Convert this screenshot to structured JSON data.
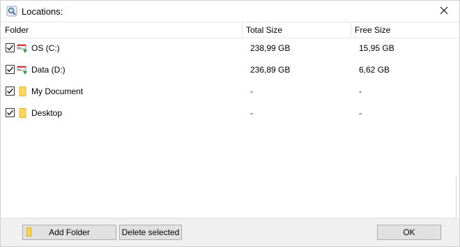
{
  "window": {
    "title": "Locations:",
    "title_icon": "magnifier-icon",
    "close_icon": "close-icon"
  },
  "table": {
    "columns": [
      "Folder",
      "Total Size",
      "Free Size"
    ],
    "rows": [
      {
        "checked": true,
        "icon": "drive-icon",
        "name": "OS (C:)",
        "total": "238,99 GB",
        "free": "15,95 GB"
      },
      {
        "checked": true,
        "icon": "drive-icon",
        "name": "Data (D:)",
        "total": "236,89 GB",
        "free": "6,62 GB"
      },
      {
        "checked": true,
        "icon": "folder-icon",
        "name": "My Document",
        "total": "-",
        "free": "-"
      },
      {
        "checked": true,
        "icon": "folder-icon",
        "name": "Desktop",
        "total": "-",
        "free": "-"
      }
    ]
  },
  "buttons": {
    "add_folder": "Add Folder",
    "delete_selected": "Delete selected",
    "ok": "OK"
  },
  "colors": {
    "folder_yellow": "#ffd75e",
    "drive_red": "#d83a3a",
    "drive_green": "#2e9a3e",
    "button_face": "#e1e1e1",
    "bottom_bar": "#f0f0f0"
  }
}
